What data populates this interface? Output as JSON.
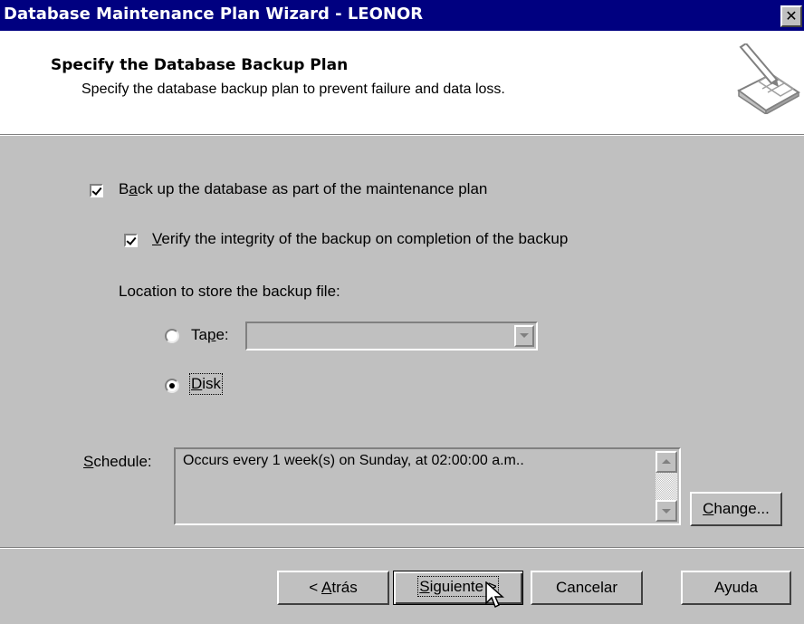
{
  "window": {
    "title": "Database Maintenance Plan Wizard - LEONOR",
    "close_icon": "close-icon"
  },
  "header": {
    "title": "Specify the Database Backup Plan",
    "subtitle": "Specify the database backup plan to prevent failure and data loss.",
    "icon": "wizard-notepad-icon"
  },
  "options": {
    "backup": {
      "pre": "B",
      "ul": "a",
      "post": "ck up the database as part of the maintenance plan",
      "checked": true
    },
    "verify": {
      "ul": "V",
      "post": "erify the integrity of the backup on completion of the backup",
      "checked": true
    }
  },
  "location": {
    "label": "Location to store the backup file:",
    "tape": {
      "pre": "Ta",
      "ul": "p",
      "post": "e:",
      "selected": false,
      "value": ""
    },
    "disk": {
      "ul": "D",
      "post": "isk",
      "selected": true
    }
  },
  "schedule": {
    "label_ul": "S",
    "label_rest": "chedule:",
    "text": "Occurs every 1 week(s) on Sunday, at 02:00:00 a.m..",
    "change": {
      "ul": "C",
      "post": "hange..."
    }
  },
  "footer": {
    "back": {
      "pre": "< ",
      "ul": "A",
      "post": "trás"
    },
    "next": {
      "ul": "S",
      "post": "iguiente >"
    },
    "cancel": "Cancelar",
    "help": "Ayuda"
  },
  "colors": {
    "titlebar": "#000080",
    "face": "#c0c0c0",
    "header_bg": "#ffffff"
  }
}
